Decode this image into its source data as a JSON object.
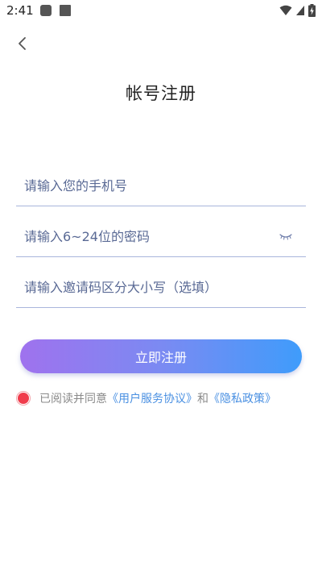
{
  "status_bar": {
    "time": "2:41",
    "icons": [
      "notification-icon",
      "notification-icon",
      "wifi-icon",
      "signal-icon",
      "battery-charging-icon"
    ]
  },
  "header": {
    "back_icon": "chevron-left-icon",
    "title": "帐号注册"
  },
  "form": {
    "phone_placeholder": "请输入您的手机号",
    "phone_value": "",
    "password_placeholder": "请输入6~24位的密码",
    "password_value": "",
    "password_toggle_icon": "eye-closed-icon",
    "invite_placeholder": "请输入邀请码区分大小写（选填）",
    "invite_value": ""
  },
  "register_button": {
    "label": "立即注册"
  },
  "agreement": {
    "checked": true,
    "prefix": "已阅读并同意",
    "terms_link": "《用户服务协议》",
    "and": "和",
    "privacy_link": "《隐私政策》"
  },
  "colors": {
    "button_gradient_start": "#9f72ee",
    "button_gradient_end": "#3f9cfb",
    "link": "#4a90e2",
    "radio_checked": "#f03c4c",
    "input_underline": "#a9b6dc"
  }
}
